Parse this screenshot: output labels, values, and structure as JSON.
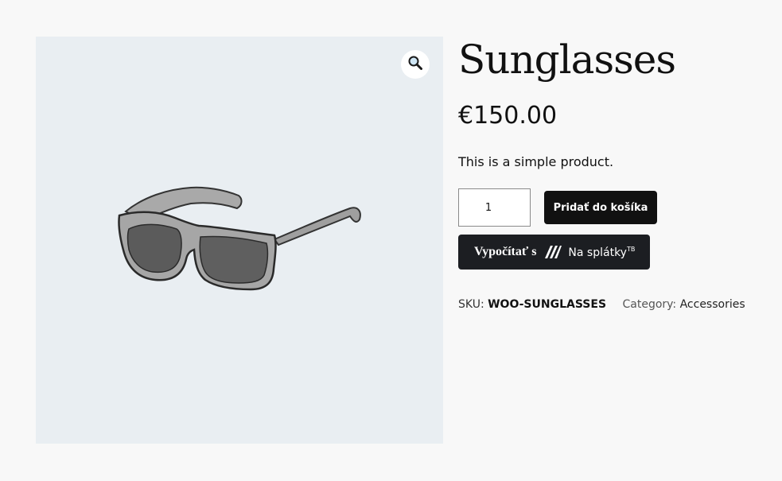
{
  "product": {
    "title": "Sunglasses",
    "price": "€150.00",
    "short_description": "This is a simple product.",
    "quantity": "1",
    "add_to_cart_label": "Pridať do košíka",
    "calculator": {
      "label": "Vypočítať s",
      "brand": "Na splátky",
      "brand_sup": "TB"
    },
    "meta": {
      "sku_label": "SKU:",
      "sku_value": "WOO-SUNGLASSES",
      "category_label": "Category:",
      "category_value": "Accessories"
    }
  },
  "icons": {
    "zoom": "magnifier-icon",
    "brand": "slash-stripes-icon"
  },
  "colors": {
    "page_bg": "#f8f8f8",
    "gallery_bg": "#e9eef2",
    "button_bg": "#111111",
    "calc_bg": "#1c1e22"
  }
}
